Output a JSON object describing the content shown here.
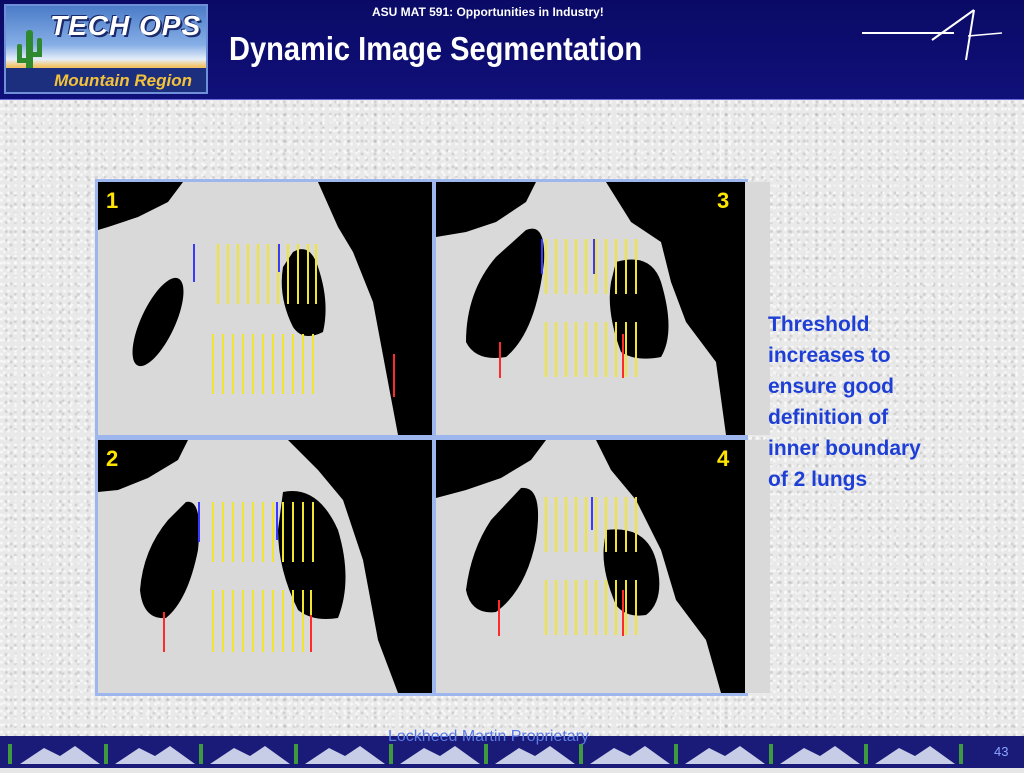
{
  "header": {
    "logo_top": "TECH OPS",
    "logo_bottom": "Mountain Region",
    "subtitle": "ASU MAT 591: Opportunities in Industry!",
    "title": "Dynamic Image Segmentation"
  },
  "panels": [
    {
      "label": "1"
    },
    {
      "label": "3"
    },
    {
      "label": "2"
    },
    {
      "label": "4"
    }
  ],
  "note": {
    "lines": [
      "Threshold",
      "increases to",
      "ensure good",
      "definition of",
      "inner boundary",
      "of 2 lungs"
    ]
  },
  "footer": {
    "proprietary": "Lockheed Martin Proprietary",
    "page_number": "43"
  },
  "colors": {
    "header_bg": "#10107a",
    "note_text": "#1e3fd6",
    "panel_number": "#ffe600",
    "grid_border": "#9db6ee"
  }
}
